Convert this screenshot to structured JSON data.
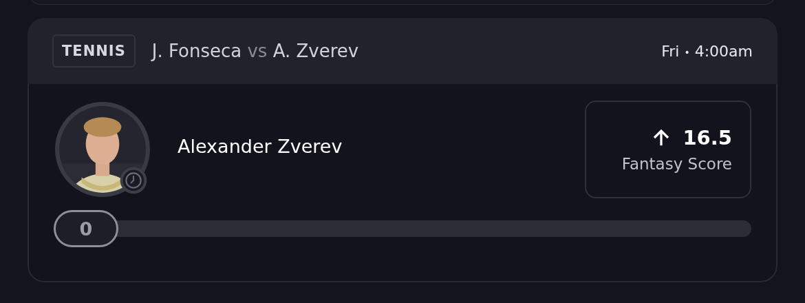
{
  "card": {
    "sport": "TENNIS",
    "player_a": "J. Fonseca",
    "vs": "vs",
    "player_b": "A. Zverev",
    "day": "Fri",
    "separator": "•",
    "time": "4:00am",
    "player_name": "Alexander Zverev",
    "avatar": {
      "kind": "picture",
      "clock_badge": true
    },
    "projection": {
      "rising": true,
      "value": "16.5",
      "label": "Fantasy Score"
    },
    "progress": {
      "level": 0,
      "value": "0"
    }
  }
}
